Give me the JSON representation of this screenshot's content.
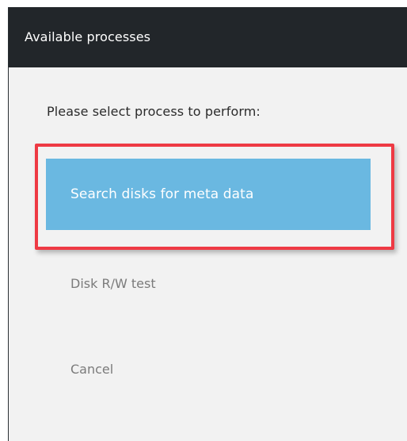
{
  "dialog": {
    "title": "Available processes",
    "prompt": "Please select process to perform:",
    "options": [
      {
        "label": "Search disks for meta data",
        "selected": true
      },
      {
        "label": "Disk R/W test",
        "selected": false
      },
      {
        "label": "Cancel",
        "selected": false
      }
    ]
  },
  "colors": {
    "titlebar": "#22262a",
    "selected_option": "#6ab8e1",
    "highlight_border": "#ee3a44",
    "background": "#f2f2f2"
  }
}
